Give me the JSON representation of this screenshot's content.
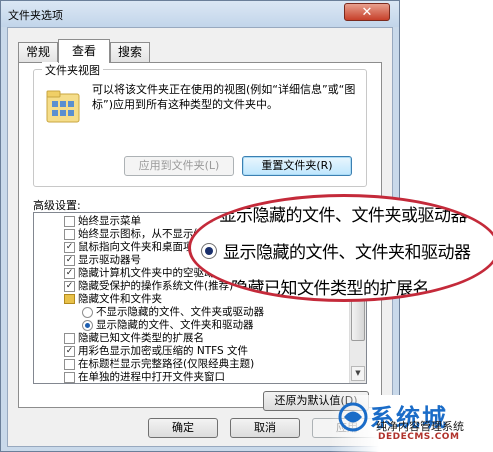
{
  "window": {
    "title": "文件夹选项",
    "close_glyph": "✕"
  },
  "tabs": [
    {
      "label": "常规",
      "active": false
    },
    {
      "label": "查看",
      "active": true
    },
    {
      "label": "搜索",
      "active": false
    }
  ],
  "folder_views": {
    "legend": "文件夹视图",
    "description": "可以将该文件夹正在使用的视图(例如“详细信息”或“图标”)应用到所有这种类型的文件夹中。",
    "apply_button": "应用到文件夹(L)",
    "reset_button": "重置文件夹(R)"
  },
  "advanced": {
    "label": "高级设置:",
    "items": [
      {
        "type": "checkbox",
        "checked": false,
        "level": 0,
        "text": "始终显示菜单"
      },
      {
        "type": "checkbox",
        "checked": false,
        "level": 0,
        "text": "始终显示图标，从不显示缩略图"
      },
      {
        "type": "checkbox",
        "checked": true,
        "level": 0,
        "text": "鼠标指向文件夹和桌面项时显示提示信息"
      },
      {
        "type": "checkbox",
        "checked": true,
        "level": 0,
        "text": "显示驱动器号"
      },
      {
        "type": "checkbox",
        "checked": true,
        "level": 0,
        "text": "隐藏计算机文件夹中的空驱动器"
      },
      {
        "type": "checkbox",
        "checked": true,
        "level": 0,
        "text": "隐藏受保护的操作系统文件(推荐)"
      },
      {
        "type": "folder",
        "checked": false,
        "level": 0,
        "text": "隐藏文件和文件夹"
      },
      {
        "type": "radio",
        "checked": false,
        "level": 1,
        "text": "不显示隐藏的文件、文件夹或驱动器"
      },
      {
        "type": "radio",
        "checked": true,
        "level": 1,
        "text": "显示隐藏的文件、文件夹和驱动器"
      },
      {
        "type": "checkbox",
        "checked": false,
        "level": 0,
        "text": "隐藏已知文件类型的扩展名"
      },
      {
        "type": "checkbox",
        "checked": true,
        "level": 0,
        "text": "用彩色显示加密或压缩的 NTFS 文件"
      },
      {
        "type": "checkbox",
        "checked": false,
        "level": 0,
        "text": "在标题栏显示完整路径(仅限经典主题)"
      },
      {
        "type": "checkbox",
        "checked": false,
        "level": 0,
        "text": "在单独的进程中打开文件夹窗口"
      }
    ],
    "restore_button": "还原为默认值(D)"
  },
  "footer": {
    "ok": "确定",
    "cancel": "取消",
    "apply": "应用"
  },
  "callout": {
    "line1": "不显示隐藏的文件、文件夹或驱动器",
    "line2": "显示隐藏的文件、文件夹和驱动器",
    "line3": "隐藏已知文件类型的扩展名"
  },
  "watermark": {
    "big": "系统城",
    "sub1": "纯净内容管理系统",
    "sub2": "DEDECMS.COM"
  },
  "colors": {
    "accent": "#c42a3a",
    "selection": "#1f5fb0"
  }
}
